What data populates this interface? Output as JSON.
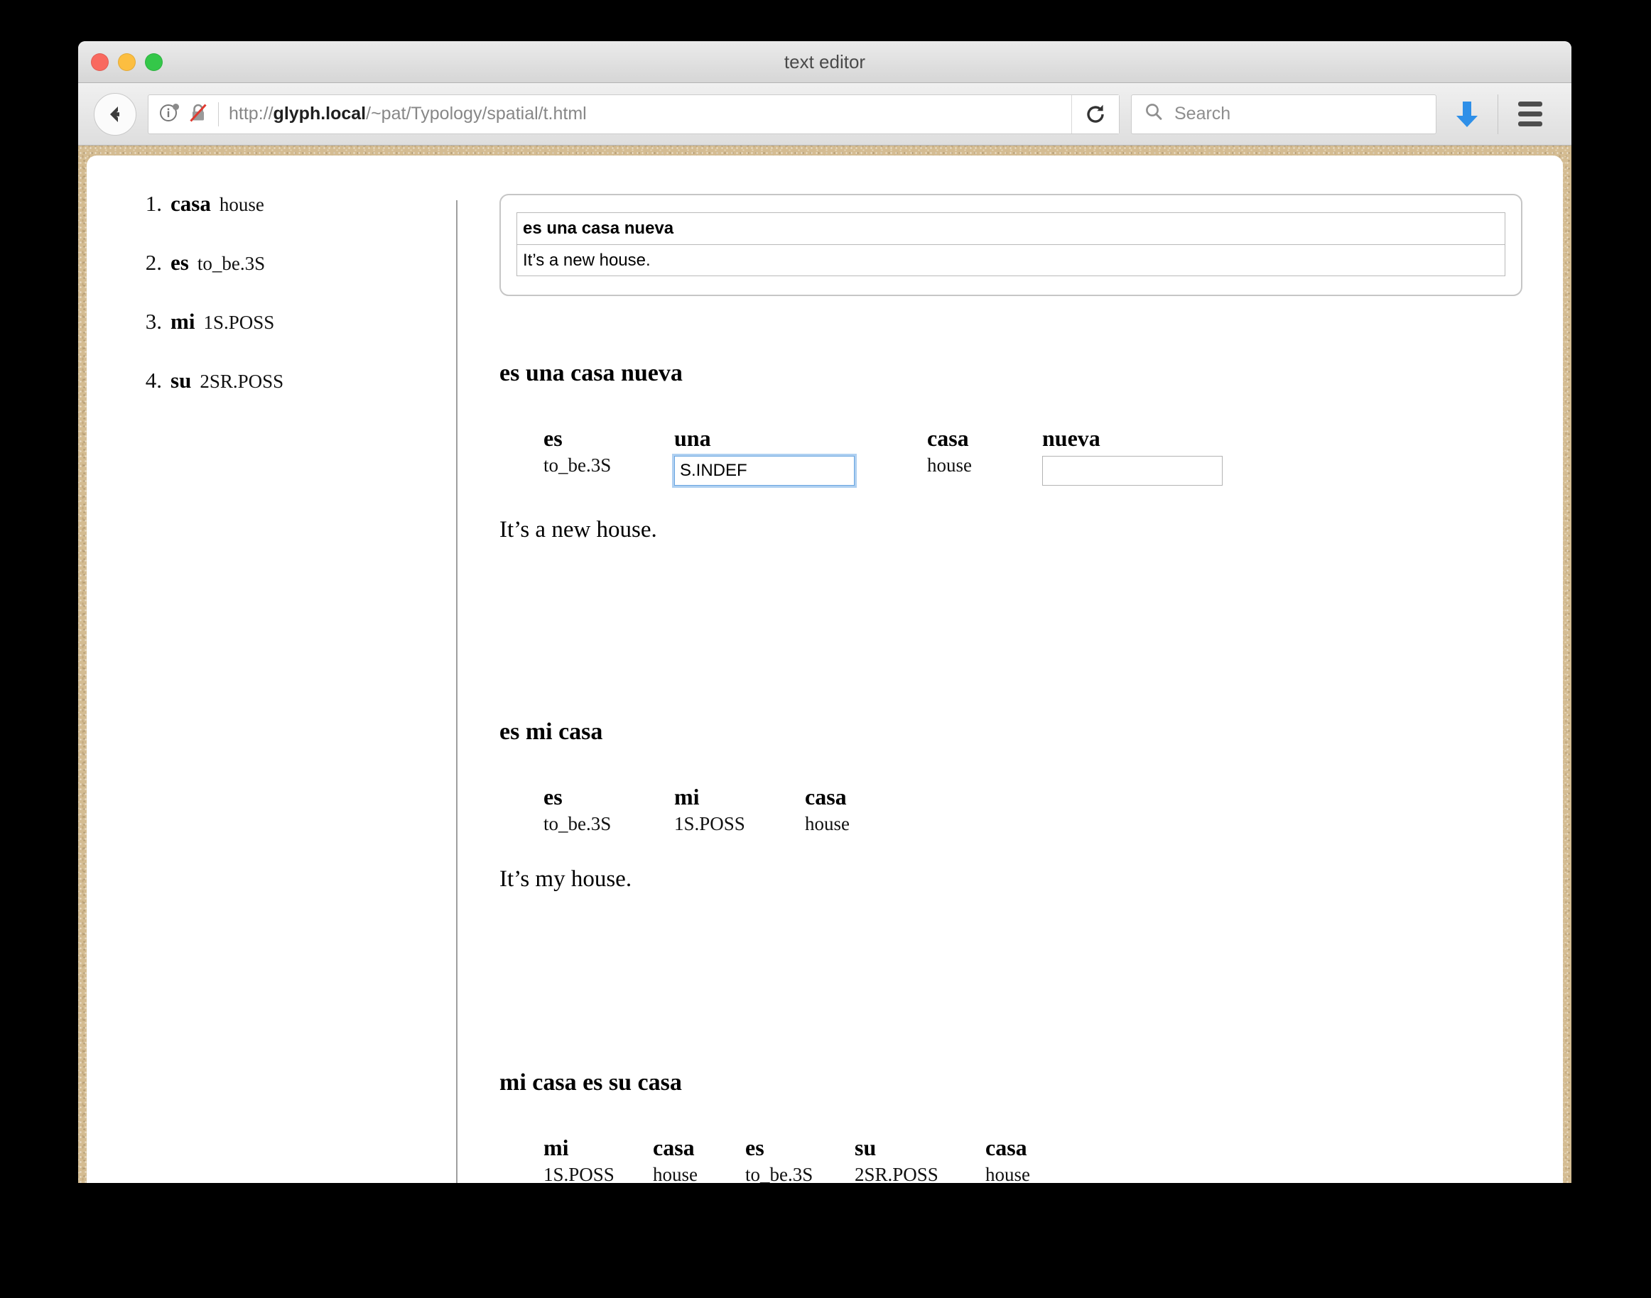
{
  "window": {
    "title": "text editor",
    "traffic_lights": [
      "close",
      "minimize",
      "zoom"
    ]
  },
  "toolbar": {
    "back_label": "Back",
    "identity_icon": "info-circle-icon",
    "security_icon": "broken-lock-icon",
    "url": "http://glyph.local/~pat/Typology/spatial/t.html",
    "url_scheme": "http://",
    "url_host": "glyph.local",
    "url_path": "/~pat/Typology/spatial/t.html",
    "reload_icon": "reload-icon",
    "search_placeholder": "Search",
    "search_value": "",
    "search_icon": "search-icon",
    "download_icon": "download-arrow-icon",
    "menu_icon": "hamburger-menu-icon"
  },
  "lexicon": {
    "items": [
      {
        "num": "1.",
        "form": "casa",
        "gloss": "house"
      },
      {
        "num": "2.",
        "form": "es",
        "gloss": "to_be.3S"
      },
      {
        "num": "3.",
        "form": "mi",
        "gloss": "1S.POSS"
      },
      {
        "num": "4.",
        "form": "su",
        "gloss": "2SR.POSS"
      }
    ]
  },
  "editor": {
    "line1_value": "es una casa nueva",
    "line1_placeholder": "",
    "line2_value": "It’s a new house.",
    "line2_placeholder": ""
  },
  "examples": [
    {
      "title": "es una casa nueva",
      "translation": "It’s a new house.",
      "words": [
        {
          "word": "es",
          "tag": "to_be.3S",
          "type": "text"
        },
        {
          "word": "una",
          "tag": "",
          "type": "input",
          "value": "S.INDEF",
          "focused": true
        },
        {
          "word": "casa",
          "tag": "house",
          "type": "text"
        },
        {
          "word": "nueva",
          "tag": "",
          "type": "input",
          "value": "",
          "focused": false
        }
      ]
    },
    {
      "title": "es mi casa",
      "translation": "It’s my house.",
      "words": [
        {
          "word": "es",
          "tag": "to_be.3S",
          "type": "text"
        },
        {
          "word": "mi",
          "tag": "1S.POSS",
          "type": "text"
        },
        {
          "word": "casa",
          "tag": "house",
          "type": "text"
        }
      ]
    },
    {
      "title": "mi casa es su casa",
      "translation": "",
      "words": [
        {
          "word": "mi",
          "tag": "1S.POSS",
          "type": "text"
        },
        {
          "word": "casa",
          "tag": "house",
          "type": "text"
        },
        {
          "word": "es",
          "tag": "to_be.3S",
          "type": "text"
        },
        {
          "word": "su",
          "tag": "2SR.POSS",
          "type": "text"
        },
        {
          "word": "casa",
          "tag": "house",
          "type": "text"
        }
      ]
    }
  ],
  "colors": {
    "desktop": "#000000",
    "page_background": "#d4bc92",
    "sheet": "#ffffff",
    "focus_ring": "#6aa5e0",
    "download_arrow": "#2e8fe8",
    "lock_slash": "#e03a30"
  }
}
